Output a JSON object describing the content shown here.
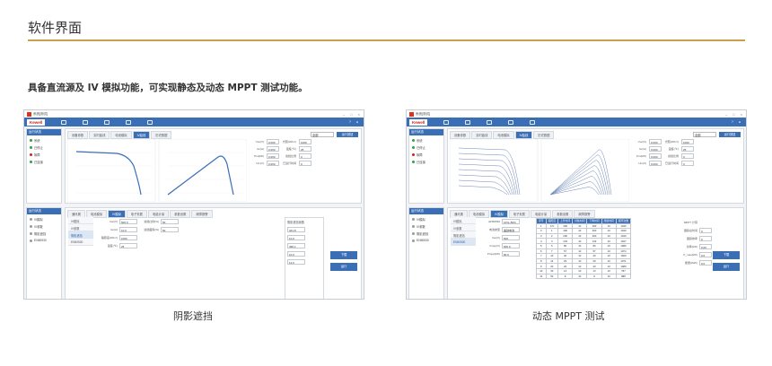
{
  "section": {
    "title": "软件界面"
  },
  "subtitle": "具备直流源及 IV 模拟功能，可实现静态及动态 MPPT 测试功能。",
  "captions": {
    "left": "阴影遮挡",
    "right": "动态 MPPT 测试"
  },
  "colors": {
    "accent_rule": "#c9a14a",
    "app_blue": "#3a6fb6",
    "brand_red": "#d12020"
  },
  "app": {
    "brand": "Kewell",
    "window_title": "系统[测试]",
    "tabs": [
      "设备参数",
      "实时曲线",
      "电池模拟",
      "IV曲线",
      "历史数据"
    ],
    "lower_tabs": [
      "通讯置",
      "电池模拟",
      "IV模拟",
      "电子负载",
      "电能计量",
      "参数设置",
      "故障报警"
    ],
    "status_items": [
      "系统",
      "已停止",
      "故障",
      "已连接"
    ],
    "status_colors": [
      "#2ea043",
      "#2ea043",
      "#d12020",
      "#2ea043"
    ],
    "dropdown": "全部",
    "run_button": "运行按钮"
  },
  "left_shot": {
    "params": [
      [
        "Uoc(V)",
        "0.000",
        "光照(W/m²)",
        "1000"
      ],
      [
        "Isc(A)",
        "0.000",
        "温度(℃)",
        "25"
      ],
      [
        "Pm(kW)",
        "0.000",
        "遮挡比例",
        "0"
      ],
      [
        "Um(V)",
        "0.000",
        "已运行时间",
        "0"
      ]
    ],
    "subnav": [
      "IV模拟",
      "IV参数",
      "阴影遮挡",
      "EN50530"
    ],
    "form": [
      [
        "Voc(V)",
        "500.0"
      ],
      [
        "Isc(A)",
        "10.0"
      ],
      [
        "辐照度(W/m²)",
        "1000"
      ],
      [
        "温度(℃)",
        "25"
      ]
    ],
    "form_right": [
      [
        "遮挡比例(%)",
        "50"
      ],
      [
        "遮挡面积(%)",
        "50"
      ]
    ],
    "group_title": "阴影遮挡参数",
    "group_values": [
      "341.8",
      "10.0",
      "490.1",
      "10.0",
      "12.6"
    ],
    "buttons": [
      "下载",
      "运行"
    ]
  },
  "right_shot": {
    "params": [
      [
        "Uoc(V)",
        "0.000",
        "光照(W/m²)",
        "1000"
      ],
      [
        "Isc(A)",
        "0.000",
        "温度(℃)",
        "25"
      ],
      [
        "Pm(kW)",
        "0.000",
        "遮挡比例",
        "0"
      ],
      [
        "Um(V)",
        "0.000",
        "已运行时间",
        "0"
      ]
    ],
    "subnav": [
      "IV模拟",
      "IV参数",
      "阴影遮挡",
      "EN50530"
    ],
    "form": [
      [
        "EN50530",
        "10%~50%"
      ],
      [
        "电池类型",
        "晶硅电池"
      ],
      [
        "Voc(V)",
        "500"
      ],
      [
        "Vmpp(V)",
        "500.0"
      ],
      [
        "Pmpp(kW)",
        "80.0"
      ]
    ],
    "table_head": [
      "序号",
      "辐照度",
      "上升时间",
      "持续时间",
      "下降时间",
      "持续时间",
      "循环次数"
    ],
    "table_rows": [
      [
        "1",
        "0.5",
        "300",
        "10",
        "300",
        "10",
        "1040"
      ],
      [
        "2",
        "1",
        "400",
        "10",
        "400",
        "10",
        "1040"
      ],
      [
        "3",
        "2",
        "200",
        "10",
        "200",
        "10",
        "1040"
      ],
      [
        "4",
        "3",
        "133",
        "10",
        "133",
        "10",
        "1047"
      ],
      [
        "5",
        "5",
        "80",
        "10",
        "80",
        "10",
        "1080"
      ],
      [
        "6",
        "7",
        "57",
        "10",
        "57",
        "10",
        "1074"
      ],
      [
        "7",
        "10",
        "40",
        "10",
        "40",
        "10",
        "1000"
      ],
      [
        "8",
        "14",
        "29",
        "10",
        "29",
        "10",
        "1071"
      ],
      [
        "9",
        "20",
        "20",
        "10",
        "20",
        "10",
        "1080"
      ],
      [
        "10",
        "30",
        "13",
        "10",
        "13",
        "10",
        "787"
      ],
      [
        "11",
        "50",
        "8",
        "10",
        "8",
        "10",
        "888"
      ]
    ],
    "side_values": [
      [
        "MPPT 计算",
        ""
      ],
      [
        "跟踪总时间",
        "0"
      ],
      [
        "跟踪效率",
        "0"
      ],
      [
        "功率(kW)",
        "0.00"
      ],
      [
        "P_max(kW)",
        "0.0"
      ],
      [
        "能量(kWh)",
        "0.0"
      ]
    ],
    "buttons": [
      "下载",
      "运行"
    ]
  }
}
